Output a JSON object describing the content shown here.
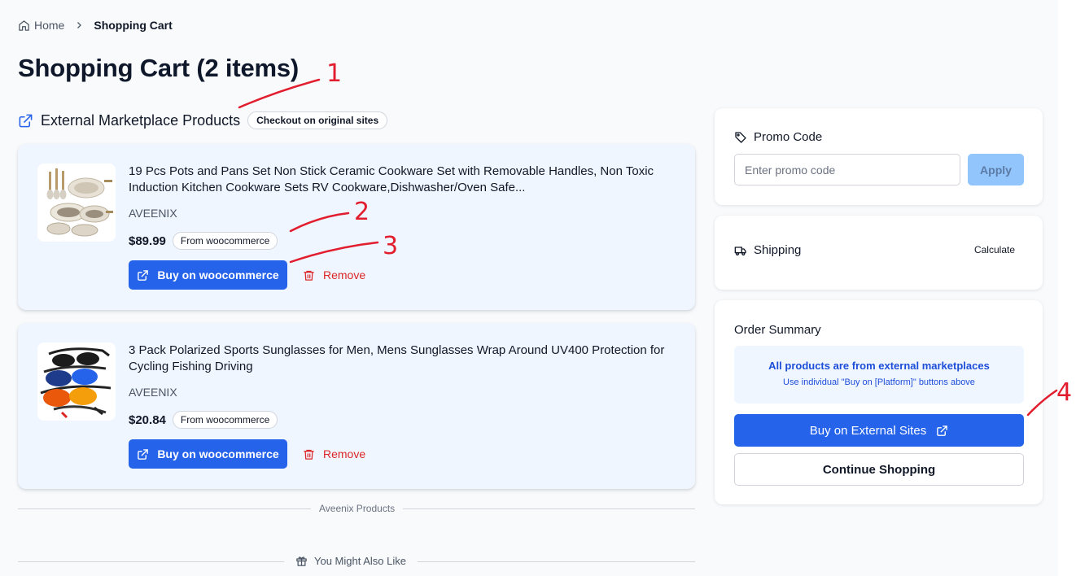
{
  "breadcrumb": {
    "home": "Home",
    "current": "Shopping Cart"
  },
  "page_title": "Shopping Cart (2 items)",
  "section": {
    "title": "External Marketplace Products",
    "badge": "Checkout on original sites"
  },
  "products": [
    {
      "name": "19 Pcs Pots and Pans Set Non Stick Ceramic Cookware Set with Removable Handles, Non Toxic Induction Kitchen Cookware Sets RV Cookware,Dishwasher/Oven Safe...",
      "brand": "AVEENIX",
      "price": "$89.99",
      "source": "From woocommerce",
      "buy_label": "Buy on woocommerce",
      "remove_label": "Remove"
    },
    {
      "name": "3 Pack Polarized Sports Sunglasses for Men, Mens Sunglasses Wrap Around UV400 Protection for Cycling Fishing Driving",
      "brand": "AVEENIX",
      "price": "$20.84",
      "source": "From woocommerce",
      "buy_label": "Buy on woocommerce",
      "remove_label": "Remove"
    }
  ],
  "divider_aveenix": "Aveenix Products",
  "divider_also_like": "You Might Also Like",
  "promo": {
    "title": "Promo Code",
    "placeholder": "Enter promo code",
    "apply": "Apply"
  },
  "shipping": {
    "title": "Shipping",
    "calculate": "Calculate"
  },
  "summary": {
    "title": "Order Summary",
    "notice_title": "All products are from external marketplaces",
    "notice_sub": "Use individual \"Buy on [Platform]\" buttons above",
    "buy_external": "Buy on External Sites",
    "continue": "Continue Shopping"
  },
  "annotations": [
    "1",
    "2",
    "3",
    "4"
  ],
  "colors": {
    "primary": "#2563eb",
    "danger": "#dc2626",
    "card_bg": "#eff6ff",
    "annotation": "#e11d2e"
  },
  "icons": [
    "home-icon",
    "chevron-right-icon",
    "external-link-icon",
    "trash-icon",
    "tag-icon",
    "truck-icon",
    "gift-icon"
  ]
}
